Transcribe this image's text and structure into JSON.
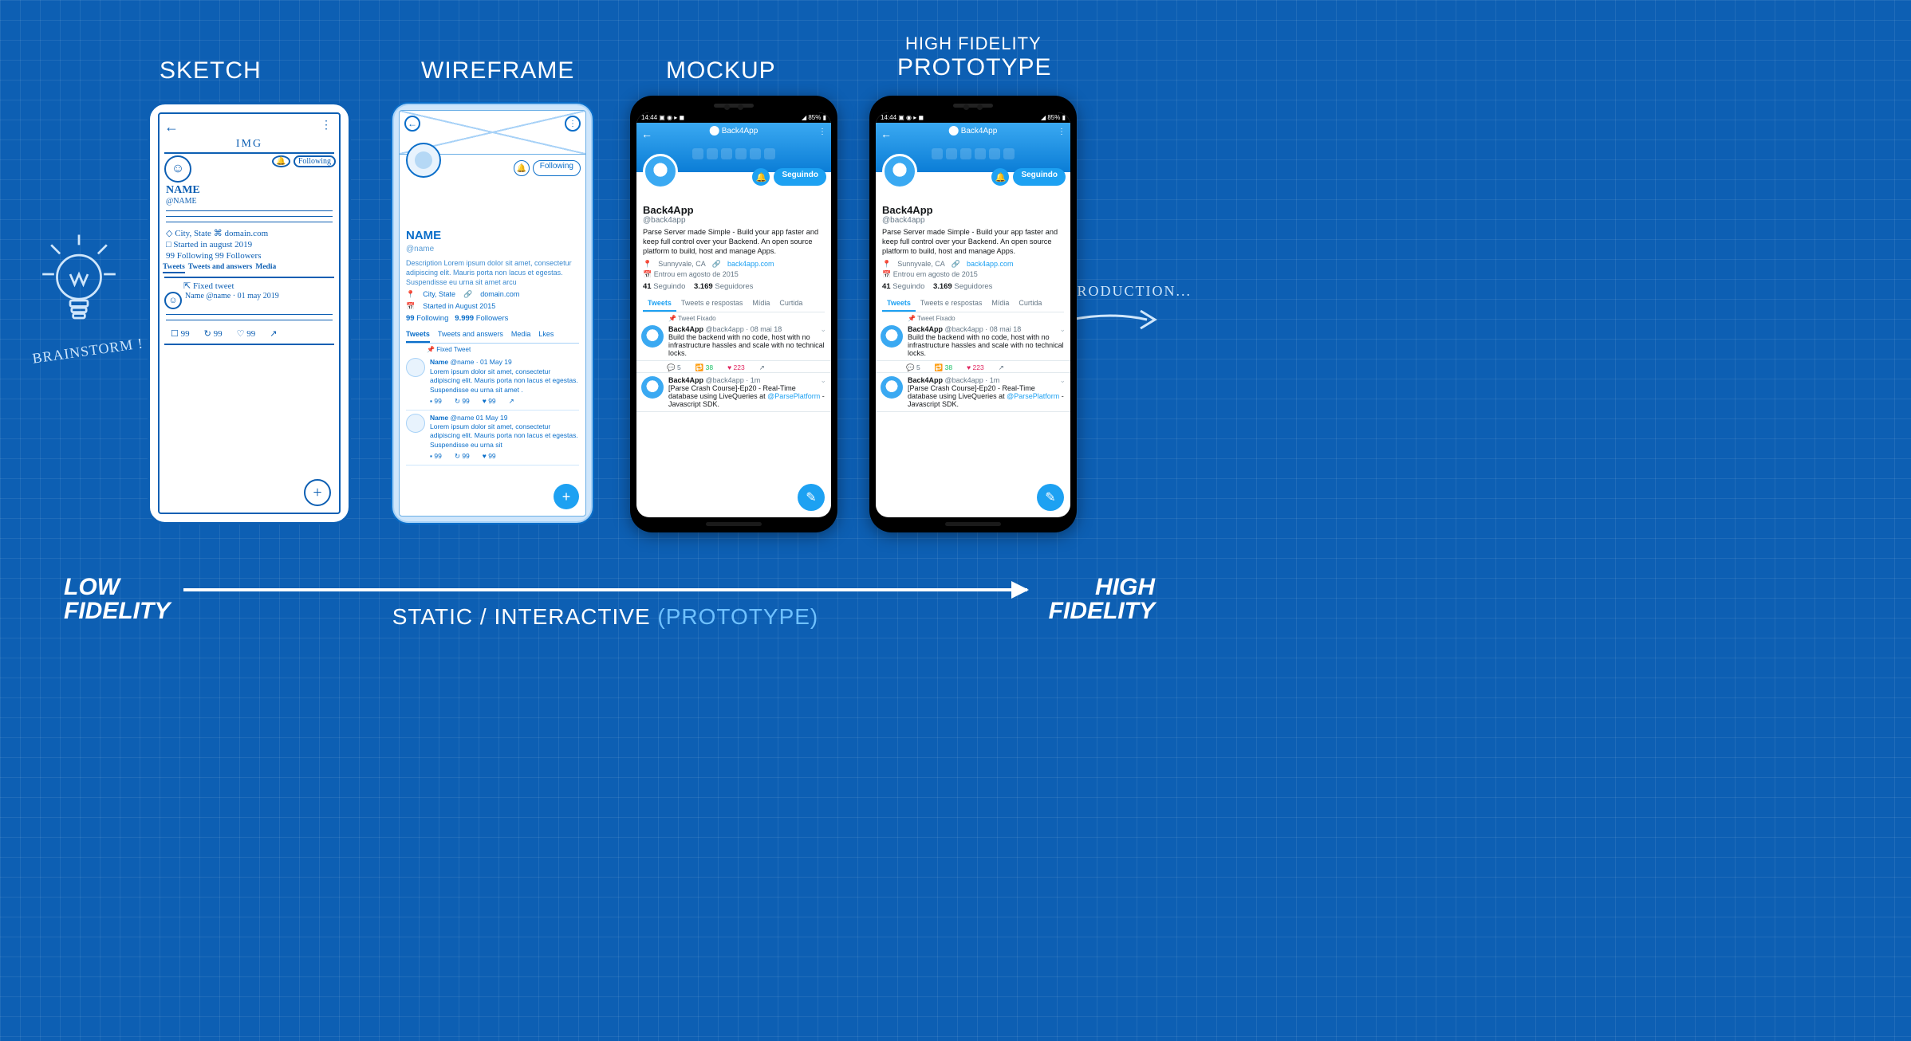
{
  "titles": {
    "sketch": "SKETCH",
    "wireframe": "WIREFRAME",
    "mockup": "MOCKUP",
    "proto_pre": "HIGH FIDELITY",
    "prototype": "PROTOTYPE"
  },
  "annotations": {
    "brainstorm": "BRAINSTORM !",
    "production": "PRODUCTION..."
  },
  "axis": {
    "low": "LOW",
    "fidelity": "FIDELITY",
    "high": "HIGH",
    "static": "STATIC / INTERACTIVE",
    "proto": "(PROTOTYPE)"
  },
  "sketch": {
    "img": "IMG",
    "following_pill": "Following",
    "name": "NAME",
    "handle": "@NAME",
    "location": "◇ City, State   ⌘ domain.com",
    "started": "□ Started in august 2019",
    "stats": "99 Following   99 Followers",
    "tabs": [
      "Tweets",
      "Tweets and answers",
      "Media"
    ],
    "fixed": "⇱ Fixed tweet",
    "tweet_line": "Name  @name · 01 may 2019",
    "icons": [
      "☐ 99",
      "↻ 99",
      "♡ 99",
      "↗"
    ]
  },
  "wireframe": {
    "following_pill": "Following",
    "name": "NAME",
    "handle": "@name",
    "desc": "Description Lorem ipsum dolor sit amet, consectetur adipiscing elit. Mauris porta non lacus et egestas. Suspendisse eu urna sit amet arcu",
    "location": "City, State",
    "domain": "domain.com",
    "started": "Started in August 2015",
    "following_n": "99",
    "following_l": "Following",
    "followers_n": "9.999",
    "followers_l": "Followers",
    "tabs": [
      "Tweets",
      "Tweets and answers",
      "Media",
      "Lkes"
    ],
    "fixed": "Fixed Tweet",
    "tweets": [
      {
        "name": "Name",
        "handle": "@name · 01 May 19",
        "body": "Lorem ipsum dolor sit amet, consectetur adipiscing elit. Mauris porta non lacus et egestas. Suspendisse eu urna sit amet ."
      },
      {
        "name": "Name",
        "handle": "@name   01 May 19",
        "body": "Lorem ipsum dolor sit amet, consectetur adipiscing elit. Mauris porta non lacus et egestas. Suspendisse eu urna sit"
      }
    ],
    "tweet_icons": [
      "▪ 99",
      "↻ 99",
      "♥ 99",
      "↗"
    ]
  },
  "mockup": {
    "status_left": "14:44 ▣ ◉ ▸ ◼",
    "status_right": "◢ 85% ▮",
    "brand": "Back4App",
    "follow_btn": "Seguindo",
    "name": "Back4App",
    "handle": "@back4app",
    "desc": "Parse Server made Simple - Build your app faster and keep full control over your Backend. An open source platform to build, host and manage Apps.",
    "location": "Sunnyvale, CA",
    "link": "back4app.com",
    "joined": "Entrou em agosto de 2015",
    "following_n": "41",
    "following_l": "Seguindo",
    "followers_n": "3.169",
    "followers_l": "Seguidores",
    "tabs": [
      "Tweets",
      "Tweets e respostas",
      "Mídia",
      "Curtida"
    ],
    "fixed": "Tweet Fixado",
    "tweets": [
      {
        "name": "Back4App",
        "handle": "@back4app · 08 mai 18",
        "body": "Build the backend with no code, host with no infrastructure hassles and scale with no technical locks."
      },
      {
        "name": "Back4App",
        "handle": "@back4app · 1m",
        "body_pre": "[Parse Crash Course]-Ep20 - Real-Time database using LiveQueries at ",
        "body_link": "@ParsePlatform",
        "body_post": " - Javascript SDK."
      }
    ],
    "icons": {
      "reply": "5",
      "rt": "38",
      "like": "223"
    }
  }
}
